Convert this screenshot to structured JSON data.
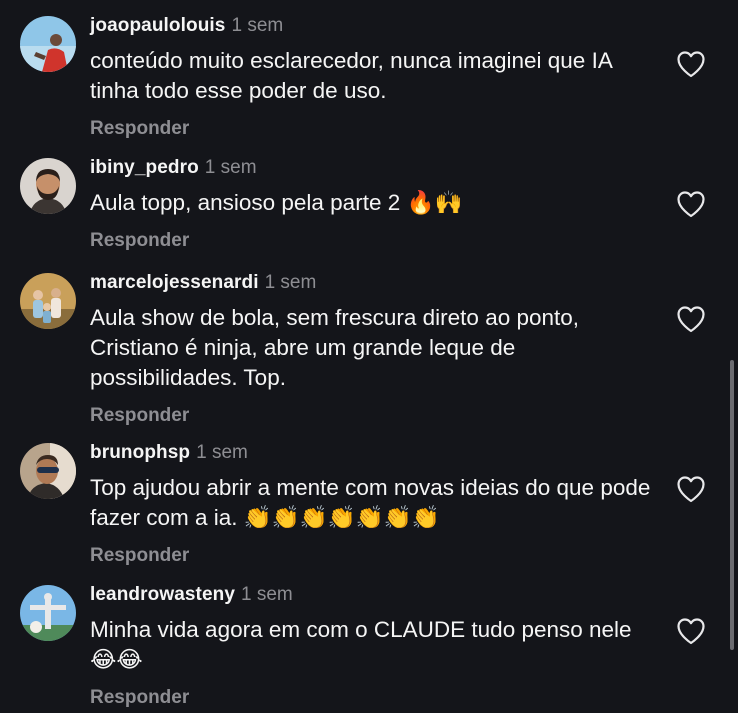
{
  "comments": [
    {
      "username": "joaopaulolouis",
      "time": "1 sem",
      "text": "conteúdo muito esclarecedor, nunca imaginei que IA tinha todo esse poder de uso.",
      "reply_label": "Responder",
      "avatar_icon": "avatar-person-red-shirt"
    },
    {
      "username": "ibiny_pedro",
      "time": "1 sem",
      "text": "Aula topp, ansioso pela parte 2 🔥🙌",
      "reply_label": "Responder",
      "avatar_icon": "avatar-bearded-man"
    },
    {
      "username": "marcelojessenardi",
      "time": "1 sem",
      "text": "Aula show de bola, sem frescura direto ao ponto, Cristiano é ninja, abre um grande leque de possibilidades. Top.",
      "reply_label": "Responder",
      "avatar_icon": "avatar-family-outdoors"
    },
    {
      "username": "brunophsp",
      "time": "1 sem",
      "text": "Top ajudou abrir a mente com novas ideias do que pode fazer com a ia. 👏👏👏👏👏👏👏",
      "reply_label": "Responder",
      "avatar_icon": "avatar-man-sunglasses"
    },
    {
      "username": "leandrowasteny",
      "time": "1 sem",
      "text": "Minha vida agora em com o CLAUDE tudo penso nele 😂😂",
      "reply_label": "Responder",
      "avatar_icon": "avatar-statue-sky"
    }
  ],
  "like_icon": "heart-outline-icon"
}
